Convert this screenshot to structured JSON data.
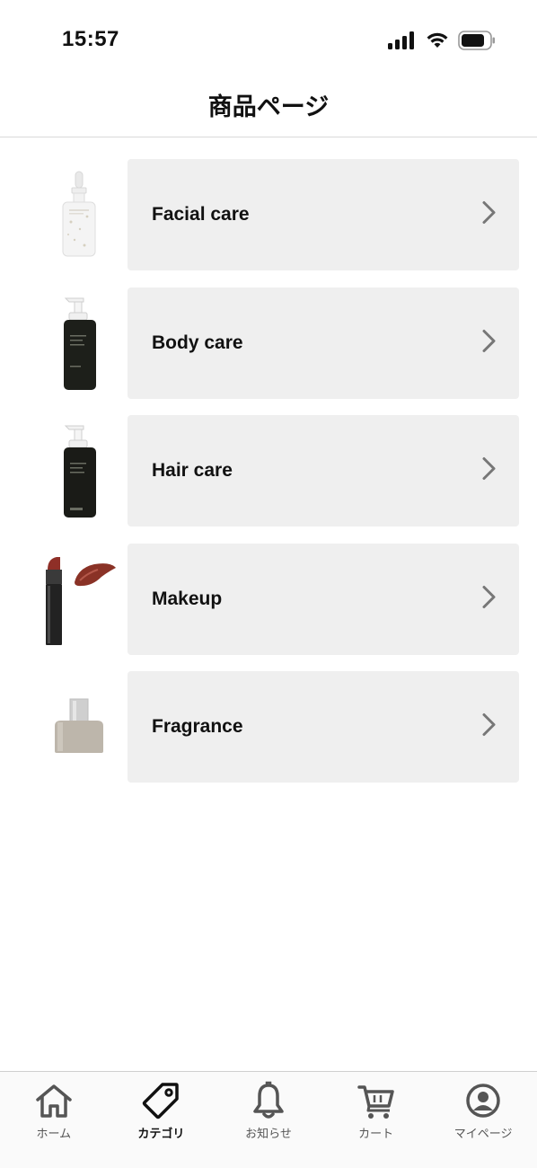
{
  "status_bar": {
    "time": "15:57"
  },
  "header": {
    "title": "商品ページ"
  },
  "categories": [
    {
      "label": "Facial care",
      "image": "serum-dropper-bottle"
    },
    {
      "label": "Body care",
      "image": "pump-bottle-dark"
    },
    {
      "label": "Hair care",
      "image": "pump-bottle-dark"
    },
    {
      "label": "Makeup",
      "image": "lipstick-with-swatch"
    },
    {
      "label": "Fragrance",
      "image": "perfume-bottle"
    }
  ],
  "tab_bar": {
    "active": "カテゴリ",
    "items": [
      {
        "label": "ホーム",
        "icon": "home-icon"
      },
      {
        "label": "カテゴリ",
        "icon": "tag-icon"
      },
      {
        "label": "お知らせ",
        "icon": "bell-icon"
      },
      {
        "label": "カート",
        "icon": "cart-icon"
      },
      {
        "label": "マイページ",
        "icon": "user-circle-icon"
      }
    ]
  },
  "colors": {
    "card_background": "#efefef",
    "chevron": "#777777",
    "text": "#111111",
    "tab_inactive": "#555555"
  }
}
